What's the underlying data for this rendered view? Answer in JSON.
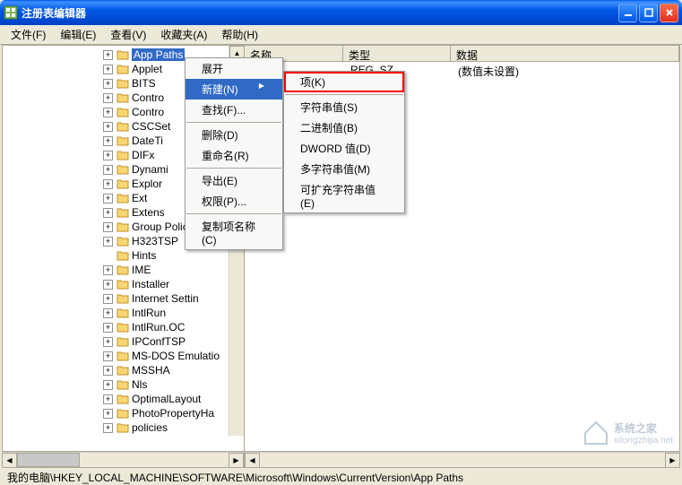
{
  "window": {
    "title": "注册表编辑器"
  },
  "menubar": {
    "file": "文件(F)",
    "edit": "编辑(E)",
    "view": "查看(V)",
    "favorites": "收藏夹(A)",
    "help": "帮助(H)"
  },
  "tree": {
    "selected": "App Paths",
    "items": [
      "App Paths",
      "Applet",
      "BITS",
      "Contro",
      "Contro",
      "CSCSet",
      "DateTi",
      "DIFx",
      "Dynami",
      "Explor",
      "Ext",
      "Extens",
      "Group Policy",
      "H323TSP",
      "Hints",
      "IME",
      "Installer",
      "Internet Settin",
      "IntlRun",
      "IntlRun.OC",
      "IPConfTSP",
      "MS-DOS Emulatio",
      "MSSHA",
      "Nls",
      "OptimalLayout",
      "PhotoPropertyHa",
      "policies"
    ]
  },
  "contextMenu1": {
    "expand": "展开",
    "new": "新建(N)",
    "find": "查找(F)...",
    "delete": "删除(D)",
    "rename": "重命名(R)",
    "export": "导出(E)",
    "permissions": "权限(P)...",
    "copyKeyName": "复制项名称(C)"
  },
  "contextMenu2": {
    "key": "项(K)",
    "stringValue": "字符串值(S)",
    "binaryValue": "二进制值(B)",
    "dwordValue": "DWORD 值(D)",
    "multiStringValue": "多字符串值(M)",
    "expandableStringValue": "可扩充字符串值(E)"
  },
  "listHeader": {
    "name": "名称",
    "type": "类型",
    "data": "数据"
  },
  "listRow": {
    "name": "",
    "type": "REG_SZ",
    "data": "(数值未设置)"
  },
  "statusbar": {
    "path": "我的电脑\\HKEY_LOCAL_MACHINE\\SOFTWARE\\Microsoft\\Windows\\CurrentVersion\\App Paths"
  },
  "watermark": {
    "text1": "系统之家",
    "text2": "xitongzhijia.net"
  }
}
